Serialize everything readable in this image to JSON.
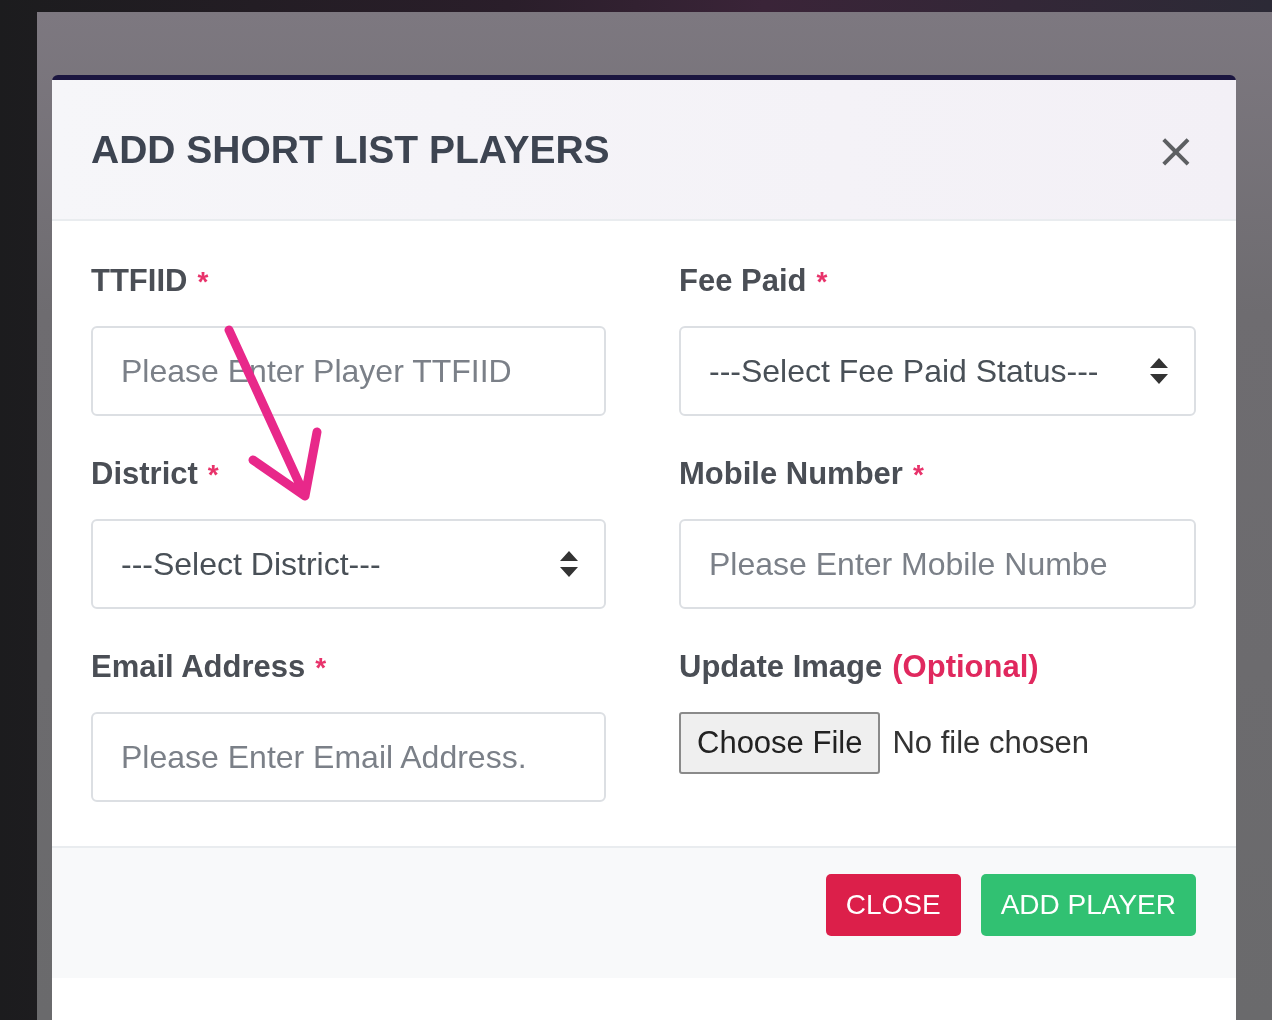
{
  "modal": {
    "title": "ADD SHORT LIST PLAYERS",
    "close": "×",
    "fields": [
      {
        "kind": "input",
        "label": "TTFIID",
        "required": "*",
        "placeholder": "Please Enter Player TTFIID"
      },
      {
        "kind": "select",
        "label": "Fee Paid",
        "required": "*",
        "value": "---Select Fee Paid Status---"
      },
      {
        "kind": "select",
        "label": "District",
        "required": "*",
        "value": "---Select District---"
      },
      {
        "kind": "input",
        "label": "Mobile Number",
        "required": "*",
        "placeholder": "Please Enter Mobile Numbe"
      },
      {
        "kind": "input",
        "label": "Email Address",
        "required": "*",
        "placeholder": "Please Enter Email Address."
      },
      {
        "kind": "file",
        "label": "Update Image",
        "note": "(Optional)",
        "button": "Choose File",
        "status": "No file chosen"
      }
    ],
    "buttons": [
      {
        "label": "CLOSE",
        "kind": "danger"
      },
      {
        "label": "ADD PLAYER",
        "kind": "success"
      }
    ]
  }
}
